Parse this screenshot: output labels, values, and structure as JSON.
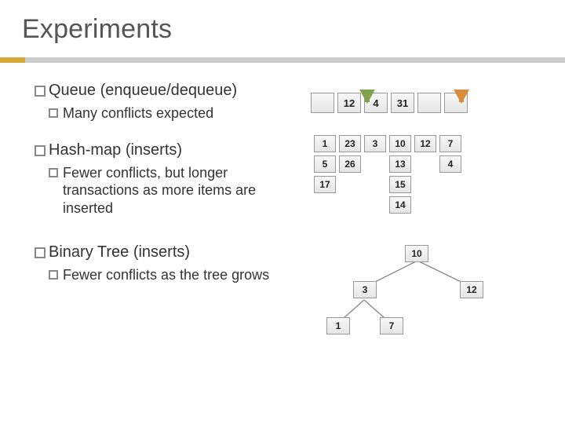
{
  "title": "Experiments",
  "sections": {
    "queue": {
      "heading": "Queue (enqueue/dequeue)",
      "sub": "Many conflicts expected"
    },
    "hashmap": {
      "heading": "Hash-map (inserts)",
      "sub": "Fewer conflicts, but longer transactions as more items are inserted"
    },
    "tree": {
      "heading": "Binary Tree (inserts)",
      "sub": "Fewer conflicts as the tree grows"
    }
  },
  "queue_data": {
    "cells": [
      "",
      "12",
      "4",
      "31",
      "",
      ""
    ],
    "arrow1_index": 1,
    "arrow2_index": 4
  },
  "hashmap_data": {
    "rows": [
      [
        "1",
        "23",
        "3",
        "10",
        "12",
        "7"
      ],
      [
        "5",
        "26",
        "",
        "13",
        "",
        "4"
      ],
      [
        "17",
        "",
        "",
        "15",
        "",
        ""
      ],
      [
        "",
        "",
        "",
        "14",
        "",
        ""
      ]
    ]
  },
  "tree_data": {
    "root": "10",
    "left": "3",
    "right": "12",
    "left_left": "1",
    "left_right": "7"
  }
}
